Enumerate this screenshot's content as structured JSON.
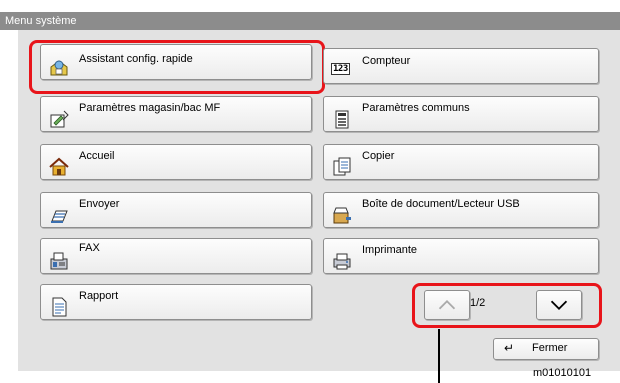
{
  "window": {
    "title": "Menu système"
  },
  "menu": {
    "quick_setup": "Assistant config. rapide",
    "counter": "Compteur",
    "counter_icon_text": "123",
    "cassette_mp": "Paramètres magasin/bac MF",
    "common": "Paramètres communs",
    "home": "Accueil",
    "copy": "Copier",
    "send": "Envoyer",
    "document_box": "Boîte de document/Lecteur USB",
    "fax": "FAX",
    "printer": "Imprimante",
    "report": "Rapport"
  },
  "pagination": {
    "indicator": "1/2"
  },
  "footer": {
    "close_label": "Fermer",
    "figure_ref": "m01010101"
  },
  "colors": {
    "highlight": "#e8141a",
    "titlebar": "#8c8c8c",
    "panel": "#e2e2e2"
  }
}
